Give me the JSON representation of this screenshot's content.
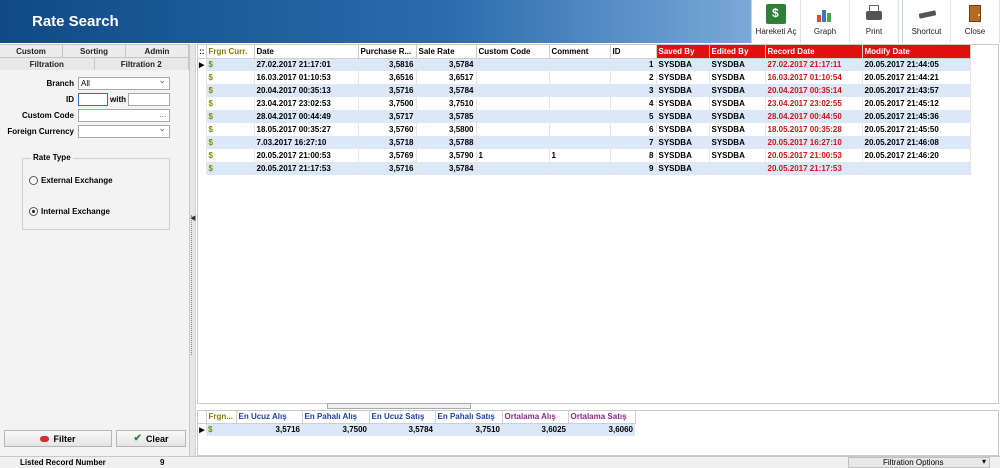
{
  "header": {
    "title": "Rate Search"
  },
  "toolbar": [
    {
      "label": "Hareketi Aç",
      "icon": "hareket-icon"
    },
    {
      "label": "Graph",
      "icon": "graph-icon"
    },
    {
      "label": "Print",
      "icon": "print-icon"
    },
    {
      "label": "Shortcut",
      "icon": "shortcut-icon"
    },
    {
      "label": "Close",
      "icon": "close-icon"
    }
  ],
  "left_tabs": {
    "custom": "Custom",
    "sorting": "Sorting",
    "admin": "Admin",
    "filtration": "Filtration",
    "filtration2": "Filtration 2"
  },
  "form": {
    "branch_label": "Branch",
    "branch_value": "All",
    "id_label": "ID",
    "id_value": "",
    "id_with_label": "with",
    "id_with_value": "",
    "custom_code_label": "Custom Code",
    "custom_code_value": "",
    "foreign_currency_label": "Foreign Currency",
    "foreign_currency_value": ""
  },
  "rate_type": {
    "legend": "Rate Type",
    "external": "External Exchange",
    "internal": "Internal Exchange",
    "selected": "internal"
  },
  "buttons": {
    "filter": "Filter",
    "clear": "Clear"
  },
  "grid": {
    "columns": [
      "Frgn Curr.",
      "Date",
      "Purchase R...",
      "Sale Rate",
      "Custom Code",
      "Comment",
      "ID",
      "Saved By",
      "Edited By",
      "Record Date",
      "Modify Date"
    ],
    "rows": [
      {
        "curr": "$",
        "date": "27.02.2017 21:17:01",
        "purchase": "3,5816",
        "sale": "3,5784",
        "custom_code": "",
        "comment": "",
        "id": "1",
        "saved_by": "SYSDBA",
        "edited_by": "SYSDBA",
        "record_date": "27.02.2017 21:17:11",
        "modify_date": "20.05.2017 21:44:05"
      },
      {
        "curr": "$",
        "date": "16.03.2017 01:10:53",
        "purchase": "3,6516",
        "sale": "3,6517",
        "custom_code": "",
        "comment": "",
        "id": "2",
        "saved_by": "SYSDBA",
        "edited_by": "SYSDBA",
        "record_date": "16.03.2017 01:10:54",
        "modify_date": "20.05.2017 21:44:21"
      },
      {
        "curr": "$",
        "date": "20.04.2017 00:35:13",
        "purchase": "3,5716",
        "sale": "3,5784",
        "custom_code": "",
        "comment": "",
        "id": "3",
        "saved_by": "SYSDBA",
        "edited_by": "SYSDBA",
        "record_date": "20.04.2017 00:35:14",
        "modify_date": "20.05.2017 21:43:57"
      },
      {
        "curr": "$",
        "date": "23.04.2017 23:02:53",
        "purchase": "3,7500",
        "sale": "3,7510",
        "custom_code": "",
        "comment": "",
        "id": "4",
        "saved_by": "SYSDBA",
        "edited_by": "SYSDBA",
        "record_date": "23.04.2017 23:02:55",
        "modify_date": "20.05.2017 21:45:12"
      },
      {
        "curr": "$",
        "date": "28.04.2017 00:44:49",
        "purchase": "3,5717",
        "sale": "3,5785",
        "custom_code": "",
        "comment": "",
        "id": "5",
        "saved_by": "SYSDBA",
        "edited_by": "SYSDBA",
        "record_date": "28.04.2017 00:44:50",
        "modify_date": "20.05.2017 21:45:36"
      },
      {
        "curr": "$",
        "date": "18.05.2017 00:35:27",
        "purchase": "3,5760",
        "sale": "3,5800",
        "custom_code": "",
        "comment": "",
        "id": "6",
        "saved_by": "SYSDBA",
        "edited_by": "SYSDBA",
        "record_date": "18.05.2017 00:35:28",
        "modify_date": "20.05.2017 21:45:50"
      },
      {
        "curr": "$",
        "date": "7.03.2017 16:27:10",
        "purchase": "3,5718",
        "sale": "3,5788",
        "custom_code": "",
        "comment": "",
        "id": "7",
        "saved_by": "SYSDBA",
        "edited_by": "SYSDBA",
        "record_date": "20.05.2017 16:27:10",
        "modify_date": "20.05.2017 21:46:08"
      },
      {
        "curr": "$",
        "date": "20.05.2017 21:00:53",
        "purchase": "3,5769",
        "sale": "3,5790",
        "custom_code": "1",
        "comment": "1",
        "id": "8",
        "saved_by": "SYSDBA",
        "edited_by": "SYSDBA",
        "record_date": "20.05.2017 21:00:53",
        "modify_date": "20.05.2017 21:46:20"
      },
      {
        "curr": "$",
        "date": "20.05.2017 21:17:53",
        "purchase": "3,5716",
        "sale": "3,5784",
        "custom_code": "",
        "comment": "",
        "id": "9",
        "saved_by": "SYSDBA",
        "edited_by": "",
        "record_date": "20.05.2017 21:17:53",
        "modify_date": ""
      }
    ]
  },
  "summary": {
    "columns": [
      "Frgn...",
      "En Ucuz Alış",
      "En Pahalı Alış",
      "En Ucuz Satış",
      "En Pahalı Satış",
      "Ortalama Alış",
      "Ortalama Satış"
    ],
    "row": [
      "$",
      "3,5716",
      "3,7500",
      "3,5784",
      "3,7510",
      "3,6025",
      "3,6060"
    ]
  },
  "status": {
    "listed_label": "Listed Record Number",
    "listed_count": "9",
    "filtration_options": "Filtration Options"
  },
  "colors": {
    "header_start": "#0f4a86",
    "header_end": "#c4d8ec",
    "red_header": "#e10f0f",
    "alt_row": "#dce8f8",
    "summary_blue": "#1f3fa8",
    "summary_purple": "#8b2a8b"
  }
}
